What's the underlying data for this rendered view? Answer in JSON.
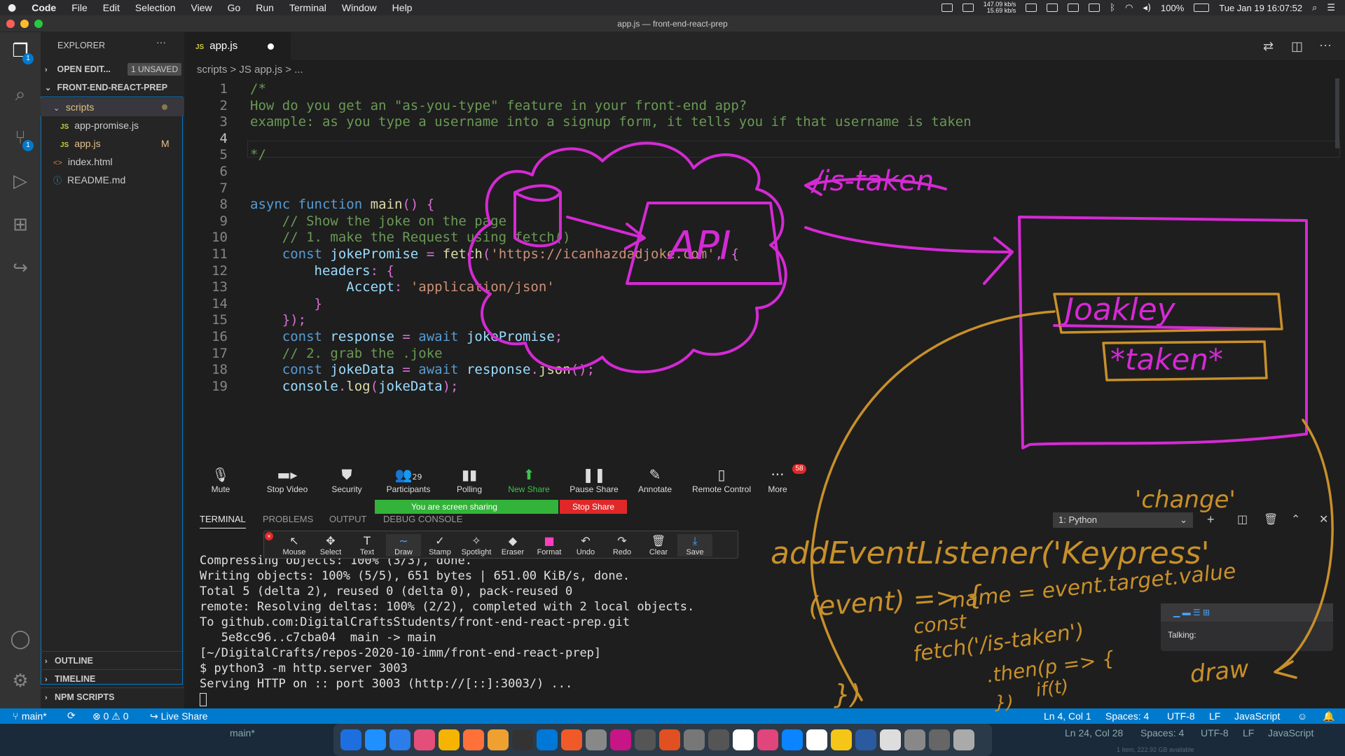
{
  "menubar": {
    "app": "Code",
    "items": [
      "File",
      "Edit",
      "Selection",
      "View",
      "Go",
      "Run",
      "Terminal",
      "Window",
      "Help"
    ],
    "net_up": "147.09 kb/s",
    "net_down": "15.69 kb/s",
    "battery": "100%",
    "datetime": "Tue Jan 19  16:07:52"
  },
  "window": {
    "title": "app.js — front-end-react-prep"
  },
  "sidebar": {
    "header": "EXPLORER",
    "open_editors": "OPEN EDIT...",
    "unsaved_badge": "1 UNSAVED",
    "project": "FRONT-END-REACT-PREP",
    "folder": "scripts",
    "files": [
      {
        "name": "app-promise.js",
        "status": ""
      },
      {
        "name": "app.js",
        "status": "M"
      },
      {
        "name": "index.html",
        "status": ""
      },
      {
        "name": "README.md",
        "status": ""
      }
    ],
    "outline": "OUTLINE",
    "timeline": "TIMELINE",
    "npm": "NPM SCRIPTS"
  },
  "activity_badges": {
    "explorer": "1",
    "scm": "1"
  },
  "editor": {
    "tab": "app.js",
    "breadcrumb": "scripts  >  JS app.js  > ...",
    "lines": [
      {
        "n": "1",
        "text": "/*"
      },
      {
        "n": "2",
        "text": "How do you get an \"as-you-type\" feature in your front-end app?"
      },
      {
        "n": "3",
        "text": "example: as you type a username into a signup form, it tells you if that username is taken"
      },
      {
        "n": "4",
        "text": ""
      },
      {
        "n": "5",
        "text": "*/"
      },
      {
        "n": "6",
        "text": ""
      },
      {
        "n": "7",
        "text": ""
      },
      {
        "n": "8",
        "text": "async function main() {"
      },
      {
        "n": "9",
        "text": "    // Show the joke on the page"
      },
      {
        "n": "10",
        "text": "    // 1. make the Request using fetch()"
      },
      {
        "n": "11",
        "text": "    const jokePromise = fetch('https://icanhazdadjoke.com', {"
      },
      {
        "n": "12",
        "text": "        headers: {"
      },
      {
        "n": "13",
        "text": "            Accept: 'application/json'"
      },
      {
        "n": "14",
        "text": "        }"
      },
      {
        "n": "15",
        "text": "    });"
      },
      {
        "n": "16",
        "text": "    const response = await jokePromise;"
      },
      {
        "n": "17",
        "text": "    // 2. grab the .joke"
      },
      {
        "n": "18",
        "text": "    const jokeData = await response.json();"
      },
      {
        "n": "19",
        "text": "    console.log(jokeData);"
      }
    ]
  },
  "zoom": {
    "buttons": [
      "Mute",
      "Stop Video",
      "Security",
      "Participants",
      "Polling",
      "New Share",
      "Pause Share",
      "Annotate",
      "Remote Control",
      "More"
    ],
    "participants_count": "29",
    "more_badge": "58",
    "sharing": "You are screen sharing",
    "stop_share": "Stop Share",
    "annotate_tools": [
      "Mouse",
      "Select",
      "Text",
      "Draw",
      "Stamp",
      "Spotlight",
      "Eraser",
      "Format",
      "Undo",
      "Redo",
      "Clear",
      "Save"
    ],
    "talking": "Talking:"
  },
  "panel": {
    "tabs": [
      "TERMINAL",
      "PROBLEMS",
      "OUTPUT",
      "DEBUG CONSOLE"
    ],
    "terminal_select": "1: Python",
    "lines": [
      "Compressing objects: 100% (3/3), done.",
      "Writing objects: 100% (5/5), 651 bytes | 651.00 KiB/s, done.",
      "Total 5 (delta 2), reused 0 (delta 0), pack-reused 0",
      "remote: Resolving deltas: 100% (2/2), completed with 2 local objects.",
      "To github.com:DigitalCraftsStudents/front-end-react-prep.git",
      "   5e8cc96..c7cba04  main -> main",
      "[~/DigitalCrafts/repos-2020-10-imm/front-end-react-prep]",
      "$ python3 -m http.server 3003",
      "Serving HTTP on :: port 3003 (http://[::]:3003/) ..."
    ]
  },
  "statusbar": {
    "branch": "main*",
    "problems": "⊗ 0 ⚠ 0",
    "liveshare": "Live Share",
    "position": "Ln 4, Col 1",
    "spaces": "Spaces: 4",
    "encoding": "UTF-8",
    "eol": "LF",
    "language": "JavaScript"
  },
  "ghost_status": {
    "branch": "main*",
    "position": "Ln 24, Col 28",
    "spaces": "Spaces: 4",
    "encoding": "UTF-8",
    "eol": "LF",
    "language": "JavaScript",
    "footer": "1 item, 222.92 GB available"
  },
  "ink": {
    "api": "API",
    "is_taken": "/is-taken",
    "oakley": "Joakley",
    "taken": "*taken*",
    "change": "'change'",
    "listener": "addEventListener('Keypress'",
    "event": "(event) => {",
    "value": "name = event.target.value",
    "const": "const",
    "fetch": "fetch('/is-taken')",
    "then": ".then(p => {",
    "if": "if(t)",
    "braces": "})",
    "closer": "})",
    "draw": "draw",
    "magenta": "#d42ad4",
    "orange": "#c8902a"
  },
  "colors": {
    "accent": "#007acc",
    "share_green": "#33b33a",
    "stop_red": "#e02828"
  }
}
